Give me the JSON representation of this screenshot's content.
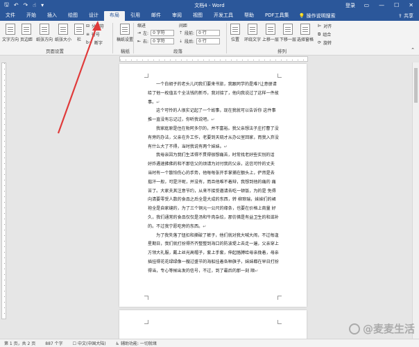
{
  "titlebar": {
    "title": "文档4 - Word",
    "login": "登录",
    "qa_icons": [
      "save-icon",
      "undo-icon",
      "redo-icon",
      "touch-icon"
    ]
  },
  "tabs": [
    {
      "label": "文件",
      "active": false
    },
    {
      "label": "开始",
      "active": false
    },
    {
      "label": "插入",
      "active": false
    },
    {
      "label": "绘图",
      "active": false
    },
    {
      "label": "设计",
      "active": false
    },
    {
      "label": "布局",
      "active": true
    },
    {
      "label": "引用",
      "active": false
    },
    {
      "label": "邮件",
      "active": false
    },
    {
      "label": "审阅",
      "active": false
    },
    {
      "label": "视图",
      "active": false
    },
    {
      "label": "开发工具",
      "active": false
    },
    {
      "label": "帮助",
      "active": false
    },
    {
      "label": "PDF工具集",
      "active": false
    }
  ],
  "tell_me": "操作说明搜索",
  "share": "共享",
  "ribbon": {
    "page_setup": {
      "label": "页面设置",
      "buttons": [
        "文字方向",
        "页边距",
        "纸张方向",
        "纸张大小",
        "栏"
      ],
      "small": [
        "分隔符",
        "行号",
        "断字"
      ]
    },
    "draft": {
      "label": "稿纸",
      "button": "稿纸设置"
    },
    "paragraph": {
      "label": "段落",
      "indent_header": "缩进",
      "spacing_header": "间距",
      "left_label": "左:",
      "left_value": "0 字符",
      "right_label": "右:",
      "right_value": "0 字符",
      "before_label": "段前:",
      "before_value": "0 行",
      "after_label": "段后:",
      "after_value": "0 行"
    },
    "arrange": {
      "label": "排列",
      "buttons": [
        "位置",
        "环绕文字",
        "上移一层",
        "下移一层",
        "选择窗格"
      ],
      "small": [
        "对齐",
        "组合",
        "旋转"
      ]
    }
  },
  "document": {
    "paragraphs": [
      "一个白胡子的老头儿问我们要来书旅，我跟同学的是难?让意册请给了他一枚值五个全法钱的新币，我对接了，他向我说过了这样一件故事。",
      "这个可怜的人很实记起了一个故事，现在我就可以告诉你 这件事推一直没有忘记过，你听我说吧。",
      "我家庭原是住在勃阿多尔的，并不富裕。我父亲想法子庄打曹了没有旁的办法，父亲在外工作，老要到天晓才从办公室回家，而我入弃没有什么大了不得，当时我说有两个妹妹。",
      "我母亲因为我们生活得不贯得很想痛苦，时常找老好些实别的话 好炸遇速拂佛的和不那信父的烦请为对付我的父亲，这信可怜的丈夫 当时有一个散怕伤心的手势，他每每张开手掌捕在额头上，俨然是去 揩汗一般，可是汗呢，并没有，而且他唯不着辩，我想到他的痛的 痛苦了。大家夫其注意节约，从来不接受邀请去吃一顿饭，为的是 免得向清要零受人数的食品之后全是大成的东西，转 柳琅瑞，妹妹们的裙袍全是自家缝的，为了三个铜元一公尺的缘条，也要在价格上商量 好久，我们通常的食品仅仅是汤和牛肉杂烩，那仿佛是有益卫生的和滋补的。不过我宁愿吃旁的东西。",
      "为了我失落了钮扣和撕破了裤子，他们就对我大喊大闹，不过每逢星期日，我们就打扮得齐齐整整到海口的防波堤上去走一遍，父亲穿上方领大礼服，戴上丝光高帽子，套上手套，伸起胳膊给母亲挽着，母亲插挂得花花绿绿像一艘过盛节的海船挂着各种旗子，妹妹都在早日打扮得当，专心等候出发的信号，不过，到了最后的那一刻 顺"
    ]
  },
  "statusbar": {
    "page": "第 1 页，共 2 页",
    "words": "887 个字",
    "track": "中文(中国大陆)",
    "accessibility": "辅助功能: 一切就绪"
  },
  "watermark": "@麦麦生活",
  "colors": {
    "accent": "#2b579a",
    "arrow": "#e03a3a"
  }
}
